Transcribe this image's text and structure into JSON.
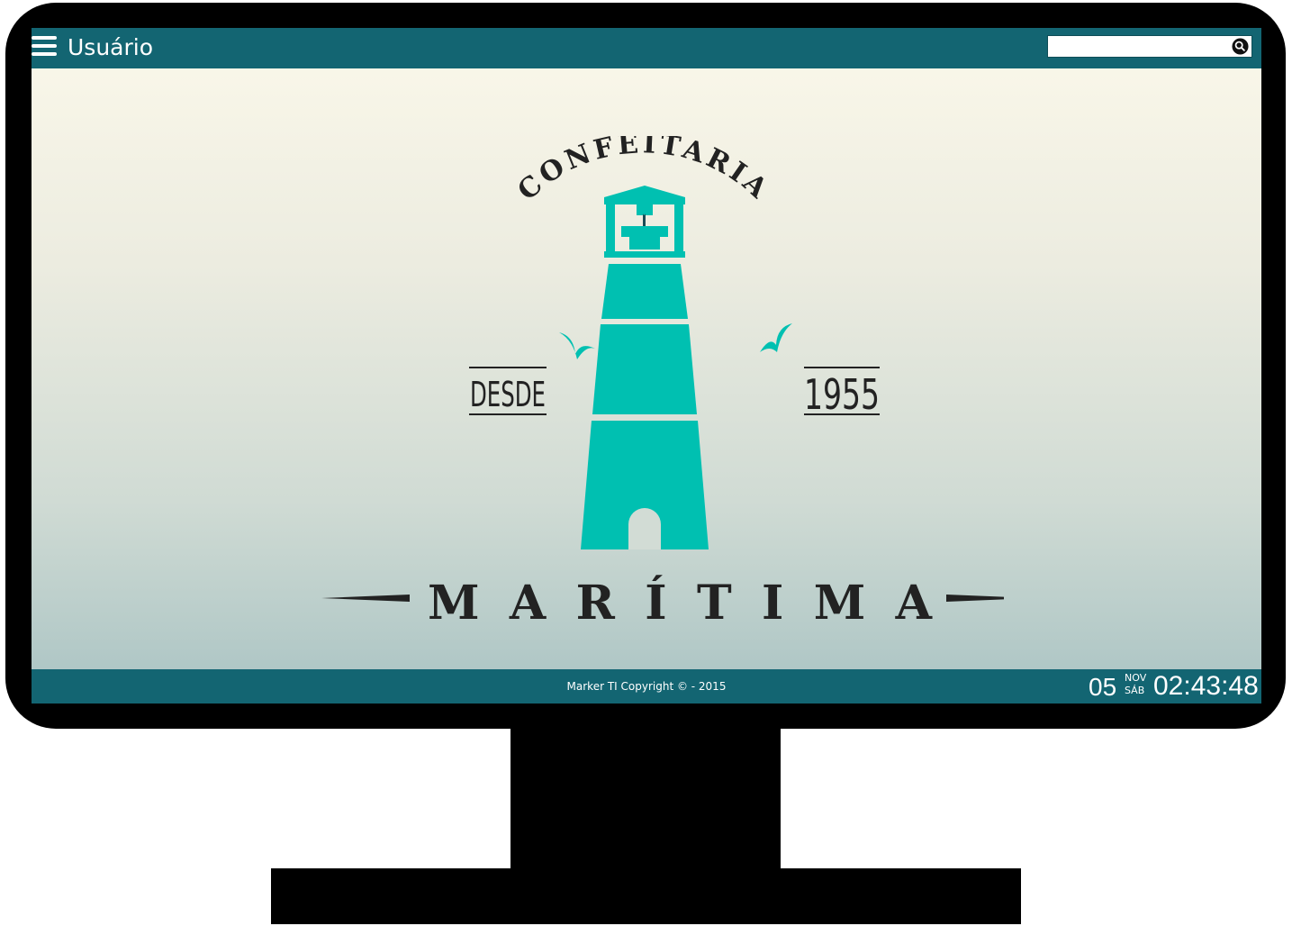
{
  "header": {
    "menu_icon": "hamburger-menu-icon",
    "user_label": "Usuário",
    "search": {
      "value": "",
      "placeholder": "",
      "icon": "search-icon"
    }
  },
  "logo": {
    "top_text": "CONFEITARIA",
    "left_text": "DESDE",
    "right_text": "1955",
    "brand_name": "MARÍTIMA",
    "brand_color": "#00c0b1",
    "text_color": "#222222"
  },
  "footer": {
    "copyright": "Marker TI Copyright © - 2015",
    "date_day": "05",
    "date_month": "NOV",
    "date_weekday": "SÁB",
    "time": "02:43:48"
  },
  "colors": {
    "bar": "#136572",
    "screen_top": "#fbf8ea",
    "screen_bottom": "#a9c3c3",
    "bezel": "#000000"
  }
}
